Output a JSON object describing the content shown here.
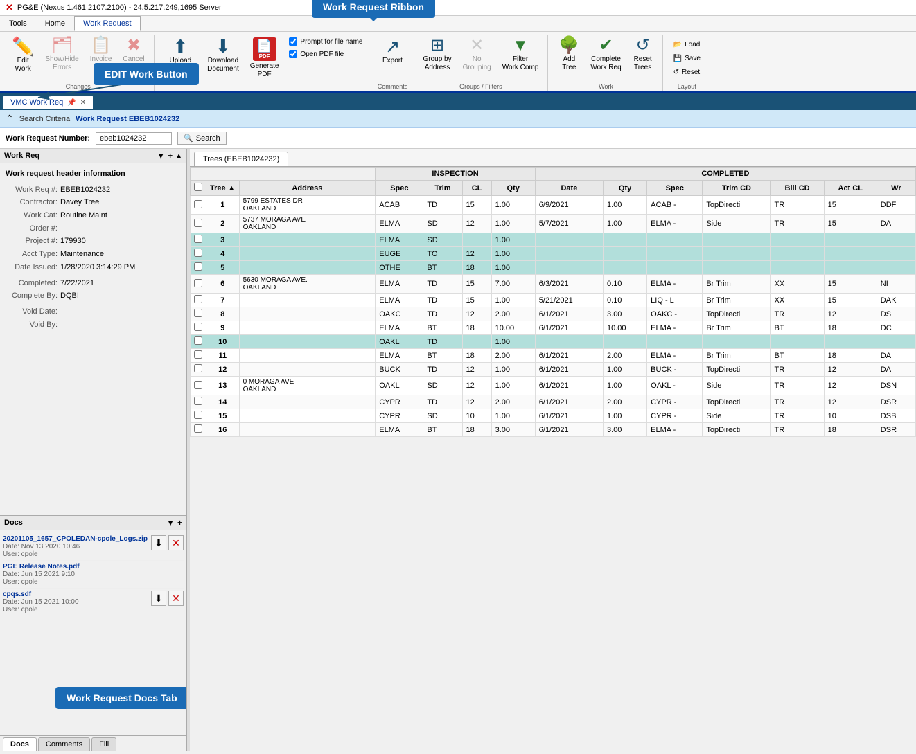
{
  "app": {
    "title": "PG&E (Nexus 1.461.2107.2100) - 24.5.217.249,1695 Server",
    "x_icon": "✕"
  },
  "menu": {
    "items": [
      "Tools",
      "Home",
      "Work Request"
    ]
  },
  "ribbon": {
    "callout_label": "Work Request Ribbon",
    "edit_callout_label": "EDIT Work Button",
    "docs_callout_label": "Work Request Docs Tab",
    "groups": {
      "changes": {
        "label": "Changes",
        "buttons": [
          {
            "id": "edit-work",
            "icon": "✏️",
            "label": "Edit\nWork"
          },
          {
            "id": "show-hide-errors",
            "icon": "⊠",
            "label": "Show/Hide\nErrors",
            "disabled": true
          },
          {
            "id": "invoice",
            "icon": "📄",
            "label": "Invoice",
            "disabled": true
          },
          {
            "id": "cancel",
            "icon": "✕",
            "label": "Cancel",
            "disabled": true
          }
        ]
      },
      "document": {
        "label": "",
        "buttons": [
          {
            "id": "upload-document",
            "icon": "⬆",
            "label": "Upload\nDocument"
          },
          {
            "id": "download-document",
            "icon": "⬇",
            "label": "Download\nDocument"
          },
          {
            "id": "generate-pdf",
            "icon": "📋",
            "label": "Generate\nPDF",
            "special": "pdf"
          }
        ],
        "checkboxes": [
          {
            "id": "prompt-filename",
            "label": "Prompt for file name",
            "checked": true
          },
          {
            "id": "open-pdf",
            "label": "Open PDF file",
            "checked": true
          }
        ]
      },
      "comments": {
        "label": "Comments",
        "buttons": [
          {
            "id": "export",
            "icon": "↗",
            "label": "Export"
          }
        ]
      },
      "groups_filters": {
        "label": "Groups / Filters",
        "buttons": [
          {
            "id": "group-by-address",
            "icon": "⊞",
            "label": "Group by\nAddress"
          },
          {
            "id": "no-grouping",
            "icon": "✕",
            "label": "No\nGrouping",
            "disabled": true
          },
          {
            "id": "filter-work-comp",
            "icon": "▼",
            "label": "Filter\nWork Comp"
          }
        ]
      },
      "work": {
        "label": "Work",
        "buttons": [
          {
            "id": "add-tree",
            "icon": "🌳",
            "label": "Add\nTree"
          },
          {
            "id": "complete-work-req",
            "icon": "✔",
            "label": "Complete\nWork Req"
          },
          {
            "id": "reset-trees",
            "icon": "↺",
            "label": "Reset\nTrees"
          }
        ]
      },
      "layout": {
        "label": "Layout",
        "buttons_small": [
          {
            "id": "load",
            "icon": "📂",
            "label": "Load"
          },
          {
            "id": "save",
            "icon": "💾",
            "label": "Save"
          },
          {
            "id": "reset",
            "icon": "↺",
            "label": "Reset"
          }
        ]
      }
    }
  },
  "tab_bar": {
    "tabs": [
      {
        "id": "vmc-work-req",
        "label": "VMC Work Req",
        "active": true,
        "pin": true,
        "close": true
      }
    ]
  },
  "search_bar": {
    "expand_icon": "⌃",
    "criteria_label": "Search Criteria",
    "criteria_value": "Work Request EBEB1024232"
  },
  "work_request_number_bar": {
    "label": "Work Request Number:",
    "value": "ebeb1024232",
    "search_label": "Search",
    "search_icon": "🔍"
  },
  "left_panel": {
    "header": "Work Req",
    "title": "Work request header information",
    "fields": [
      {
        "label": "Work Req #:",
        "value": "EBEB1024232"
      },
      {
        "label": "Contractor:",
        "value": "Davey Tree"
      },
      {
        "label": "Work Cat:",
        "value": "Routine Maint"
      },
      {
        "label": "Order #:",
        "value": ""
      },
      {
        "label": "Project #:",
        "value": "179930"
      },
      {
        "label": "Acct Type:",
        "value": "Maintenance"
      },
      {
        "label": "Date Issued:",
        "value": "1/28/2020 3:14:29 PM"
      },
      {
        "label": "Completed:",
        "value": "7/22/2021"
      },
      {
        "label": "Complete By:",
        "value": "DQBI"
      },
      {
        "label": "Void Date:",
        "value": ""
      },
      {
        "label": "Void By:",
        "value": ""
      }
    ]
  },
  "docs_panel": {
    "header": "Docs",
    "items": [
      {
        "name": "20201105_1657_CPOLEDAN-cpole_Logs.zip",
        "date": "Date: Nov 13 2020 10:46",
        "user": "User: cpole",
        "actions": [
          "download",
          "delete"
        ]
      },
      {
        "name": "PGE Release Notes.pdf",
        "date": "Date: Jun 15 2021 9:10",
        "user": "User: cpole",
        "actions": []
      },
      {
        "name": "cpqs.sdf",
        "date": "Date: Jun 15 2021 10:00",
        "user": "User: cpole",
        "actions": [
          "download",
          "delete"
        ]
      }
    ]
  },
  "bottom_tabs": {
    "tabs": [
      {
        "id": "docs",
        "label": "Docs",
        "active": true
      },
      {
        "id": "comments",
        "label": "Comments"
      },
      {
        "id": "fill",
        "label": "Fill"
      }
    ]
  },
  "trees_panel": {
    "tab_label": "Trees (EBEB1024232)",
    "col_headers_row1": [
      {
        "label": "",
        "colspan": 3
      },
      {
        "label": "INSPECTION",
        "colspan": 5
      },
      {
        "label": "COMPLETED",
        "colspan": 7
      }
    ],
    "col_headers_row2": [
      {
        "label": "",
        "key": "check"
      },
      {
        "label": "Tree",
        "key": "tree",
        "sort": "asc"
      },
      {
        "label": "Address",
        "key": "address"
      },
      {
        "label": "Spec",
        "key": "spec"
      },
      {
        "label": "Trim",
        "key": "trim"
      },
      {
        "label": "CL",
        "key": "cl"
      },
      {
        "label": "Qty",
        "key": "qty"
      },
      {
        "label": "Date",
        "key": "date"
      },
      {
        "label": "Qty",
        "key": "qty2"
      },
      {
        "label": "Spec",
        "key": "spec2"
      },
      {
        "label": "Trim CD",
        "key": "trimcd"
      },
      {
        "label": "Bill CD",
        "key": "billcd"
      },
      {
        "label": "Act CL",
        "key": "actcl"
      },
      {
        "label": "Wr",
        "key": "wr"
      }
    ],
    "rows": [
      {
        "tree": "1",
        "address": "5799 ESTATES DR\nOAKLAND",
        "spec": "ACAB",
        "trim": "TD",
        "cl": "15",
        "qty": "1.00",
        "date": "6/9/2021",
        "qty2": "1.00",
        "spec2": "ACAB -",
        "trimcd": "TopDirecti",
        "billcd": "TR",
        "actcl": "15",
        "wr": "DDF",
        "style": "white"
      },
      {
        "tree": "2",
        "address": "5737 MORAGA AVE\nOAKLAND",
        "spec": "ELMA",
        "trim": "SD",
        "cl": "12",
        "qty": "1.00",
        "date": "5/7/2021",
        "qty2": "1.00",
        "spec2": "ELMA -",
        "trimcd": "Side",
        "billcd": "TR",
        "actcl": "15",
        "wr": "DA",
        "style": "white"
      },
      {
        "tree": "3",
        "address": "",
        "spec": "ELMA",
        "trim": "SD",
        "cl": "",
        "qty": "1.00",
        "date": "",
        "qty2": "",
        "spec2": "",
        "trimcd": "",
        "billcd": "",
        "actcl": "",
        "wr": "",
        "style": "teal"
      },
      {
        "tree": "4",
        "address": "",
        "spec": "EUGE",
        "trim": "TO",
        "cl": "12",
        "qty": "1.00",
        "date": "",
        "qty2": "",
        "spec2": "",
        "trimcd": "",
        "billcd": "",
        "actcl": "",
        "wr": "",
        "style": "teal"
      },
      {
        "tree": "5",
        "address": "",
        "spec": "OTHE",
        "trim": "BT",
        "cl": "18",
        "qty": "1.00",
        "date": "",
        "qty2": "",
        "spec2": "",
        "trimcd": "",
        "billcd": "",
        "actcl": "",
        "wr": "",
        "style": "teal"
      },
      {
        "tree": "6",
        "address": "5630 MORAGA AVE.\nOAKLAND",
        "spec": "ELMA",
        "trim": "TD",
        "cl": "15",
        "qty": "7.00",
        "date": "6/3/2021",
        "qty2": "0.10",
        "spec2": "ELMA -",
        "trimcd": "Br Trim",
        "billcd": "XX",
        "actcl": "15",
        "wr": "NI",
        "style": "white"
      },
      {
        "tree": "7",
        "address": "",
        "spec": "ELMA",
        "trim": "TD",
        "cl": "15",
        "qty": "1.00",
        "date": "5/21/2021",
        "qty2": "0.10",
        "spec2": "LIQ - L",
        "trimcd": "Br Trim",
        "billcd": "XX",
        "actcl": "15",
        "wr": "DAK",
        "style": "white"
      },
      {
        "tree": "8",
        "address": "",
        "spec": "OAKC",
        "trim": "TD",
        "cl": "12",
        "qty": "2.00",
        "date": "6/1/2021",
        "qty2": "3.00",
        "spec2": "OAKC -",
        "trimcd": "TopDirecti",
        "billcd": "TR",
        "actcl": "12",
        "wr": "DS",
        "style": "white"
      },
      {
        "tree": "9",
        "address": "",
        "spec": "ELMA",
        "trim": "BT",
        "cl": "18",
        "qty": "10.00",
        "date": "6/1/2021",
        "qty2": "10.00",
        "spec2": "ELMA -",
        "trimcd": "Br Trim",
        "billcd": "BT",
        "actcl": "18",
        "wr": "DC",
        "style": "white"
      },
      {
        "tree": "10",
        "address": "",
        "spec": "OAKL",
        "trim": "TD",
        "cl": "",
        "qty": "1.00",
        "date": "",
        "qty2": "",
        "spec2": "",
        "trimcd": "",
        "billcd": "",
        "actcl": "",
        "wr": "",
        "style": "teal"
      },
      {
        "tree": "11",
        "address": "",
        "spec": "ELMA",
        "trim": "BT",
        "cl": "18",
        "qty": "2.00",
        "date": "6/1/2021",
        "qty2": "2.00",
        "spec2": "ELMA -",
        "trimcd": "Br Trim",
        "billcd": "BT",
        "actcl": "18",
        "wr": "DA",
        "style": "white"
      },
      {
        "tree": "12",
        "address": "",
        "spec": "BUCK",
        "trim": "TD",
        "cl": "12",
        "qty": "1.00",
        "date": "6/1/2021",
        "qty2": "1.00",
        "spec2": "BUCK -",
        "trimcd": "TopDirecti",
        "billcd": "TR",
        "actcl": "12",
        "wr": "DA",
        "style": "white"
      },
      {
        "tree": "13",
        "address": "0 MORAGA AVE\nOAKLAND",
        "spec": "OAKL",
        "trim": "SD",
        "cl": "12",
        "qty": "1.00",
        "date": "6/1/2021",
        "qty2": "1.00",
        "spec2": "OAKL -",
        "trimcd": "Side",
        "billcd": "TR",
        "actcl": "12",
        "wr": "DSN",
        "style": "white"
      },
      {
        "tree": "14",
        "address": "",
        "spec": "CYPR",
        "trim": "TD",
        "cl": "12",
        "qty": "2.00",
        "date": "6/1/2021",
        "qty2": "2.00",
        "spec2": "CYPR -",
        "trimcd": "TopDirecti",
        "billcd": "TR",
        "actcl": "12",
        "wr": "DSR",
        "style": "white"
      },
      {
        "tree": "15",
        "address": "",
        "spec": "CYPR",
        "trim": "SD",
        "cl": "10",
        "qty": "1.00",
        "date": "6/1/2021",
        "qty2": "1.00",
        "spec2": "CYPR -",
        "trimcd": "Side",
        "billcd": "TR",
        "actcl": "10",
        "wr": "DSB",
        "style": "white"
      },
      {
        "tree": "16",
        "address": "",
        "spec": "ELMA",
        "trim": "BT",
        "cl": "18",
        "qty": "3.00",
        "date": "6/1/2021",
        "qty2": "3.00",
        "spec2": "ELMA -",
        "trimcd": "TopDirecti",
        "billcd": "TR",
        "actcl": "18",
        "wr": "DSR",
        "style": "white"
      }
    ]
  },
  "colors": {
    "header_bg": "#1a5276",
    "ribbon_accent": "#003399",
    "teal_row": "#b2dfdb",
    "cream_row": "#fff8e1",
    "callout_blue": "#1a6bb5"
  }
}
